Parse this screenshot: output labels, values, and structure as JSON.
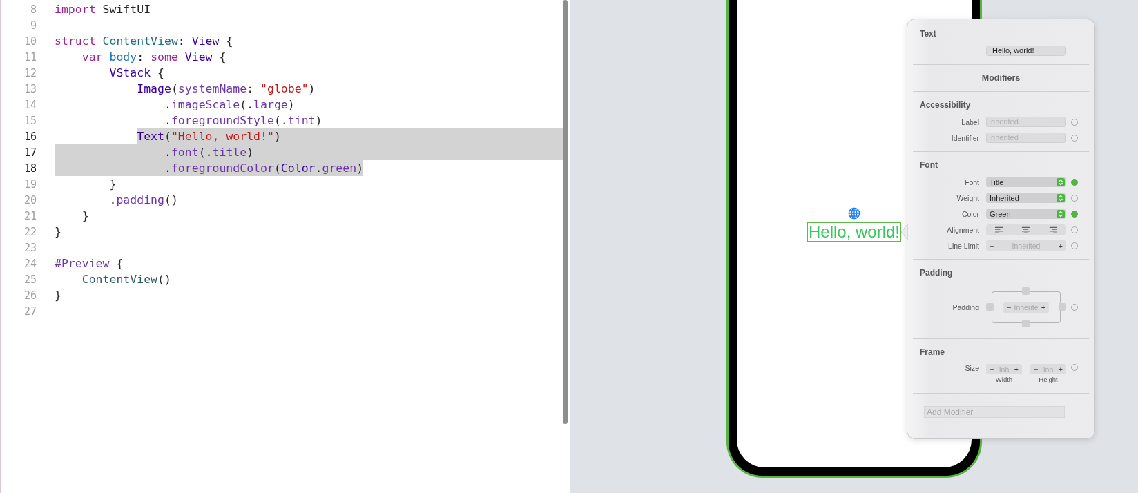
{
  "editor": {
    "lines": [
      {
        "number": "8",
        "selected": false,
        "tokens": [
          {
            "text": "import ",
            "kind": "keyword"
          },
          {
            "text": "SwiftUI",
            "kind": "plain"
          }
        ]
      },
      {
        "number": "9",
        "selected": false
      },
      {
        "number": "10",
        "selected": false,
        "tokens": [
          {
            "text": "struct ",
            "kind": "keyword"
          },
          {
            "text": "ContentView",
            "kind": "decl"
          },
          {
            "text": ": ",
            "kind": "plain"
          },
          {
            "text": "View",
            "kind": "type"
          },
          {
            "text": " {",
            "kind": "plain"
          }
        ]
      },
      {
        "number": "11",
        "selected": false,
        "tokens": [
          {
            "text": "    var ",
            "kind": "keyword"
          },
          {
            "text": "body",
            "kind": "property"
          },
          {
            "text": ": ",
            "kind": "plain"
          },
          {
            "text": "some ",
            "kind": "keyword"
          },
          {
            "text": "View",
            "kind": "type"
          },
          {
            "text": " {",
            "kind": "plain"
          }
        ]
      },
      {
        "number": "12",
        "selected": false,
        "tokens": [
          {
            "text": "        VStack",
            "kind": "type"
          },
          {
            "text": " {",
            "kind": "plain"
          }
        ]
      },
      {
        "number": "13",
        "selected": false,
        "tokens": [
          {
            "text": "            Image",
            "kind": "type"
          },
          {
            "text": "(",
            "kind": "plain"
          },
          {
            "text": "systemName",
            "kind": "member"
          },
          {
            "text": ": ",
            "kind": "plain"
          },
          {
            "text": "\"globe\"",
            "kind": "string"
          },
          {
            "text": ")",
            "kind": "plain"
          }
        ]
      },
      {
        "number": "14",
        "selected": false,
        "tokens": [
          {
            "text": "                .",
            "kind": "plain"
          },
          {
            "text": "imageScale",
            "kind": "member"
          },
          {
            "text": "(.",
            "kind": "plain"
          },
          {
            "text": "large",
            "kind": "member"
          },
          {
            "text": ")",
            "kind": "plain"
          }
        ]
      },
      {
        "number": "15",
        "selected": false,
        "tokens": [
          {
            "text": "                .",
            "kind": "plain"
          },
          {
            "text": "foregroundStyle",
            "kind": "member"
          },
          {
            "text": "(.",
            "kind": "plain"
          },
          {
            "text": "tint",
            "kind": "member"
          },
          {
            "text": ")",
            "kind": "plain"
          }
        ]
      },
      {
        "number": "16",
        "selected": true,
        "tokens": [
          {
            "text": "            Text",
            "kind": "type",
            "selected": true
          },
          {
            "text": "(",
            "kind": "plain",
            "selected": true
          },
          {
            "text": "\"Hello, world!\"",
            "kind": "string",
            "selected": true
          },
          {
            "text": ")",
            "kind": "plain",
            "selected": true
          }
        ]
      },
      {
        "number": "17",
        "selected": true,
        "tokens": [
          {
            "text": "                .",
            "kind": "plain",
            "selected": true
          },
          {
            "text": "font",
            "kind": "member",
            "selected": true
          },
          {
            "text": "(.",
            "kind": "plain",
            "selected": true
          },
          {
            "text": "title",
            "kind": "member",
            "selected": true
          },
          {
            "text": ")",
            "kind": "plain",
            "selected": true
          }
        ]
      },
      {
        "number": "18",
        "selected": true,
        "tokens": [
          {
            "text": "                .",
            "kind": "plain",
            "selected": true
          },
          {
            "text": "foregroundColor",
            "kind": "member",
            "selected": true
          },
          {
            "text": "(",
            "kind": "plain",
            "selected": true
          },
          {
            "text": "Color",
            "kind": "type",
            "selected": true
          },
          {
            "text": ".",
            "kind": "plain",
            "selected": true
          },
          {
            "text": "green",
            "kind": "member",
            "selected": true
          },
          {
            "text": ")",
            "kind": "plain",
            "selected": true
          }
        ]
      },
      {
        "number": "19",
        "selected": false,
        "tokens": [
          {
            "text": "        }",
            "kind": "plain"
          }
        ]
      },
      {
        "number": "20",
        "selected": false,
        "tokens": [
          {
            "text": "        .",
            "kind": "plain"
          },
          {
            "text": "padding",
            "kind": "member"
          },
          {
            "text": "()",
            "kind": "plain"
          }
        ]
      },
      {
        "number": "21",
        "selected": false,
        "tokens": [
          {
            "text": "    }",
            "kind": "plain"
          }
        ]
      },
      {
        "number": "22",
        "selected": false,
        "tokens": [
          {
            "text": "}",
            "kind": "plain"
          }
        ]
      },
      {
        "number": "23",
        "selected": false
      },
      {
        "number": "24",
        "selected": false,
        "tokens": [
          {
            "text": "#Preview",
            "kind": "macro"
          },
          {
            "text": " {",
            "kind": "plain"
          }
        ]
      },
      {
        "number": "25",
        "selected": false,
        "tokens": [
          {
            "text": "    ContentView",
            "kind": "ref"
          },
          {
            "text": "()",
            "kind": "plain"
          }
        ]
      },
      {
        "number": "26",
        "selected": false,
        "tokens": [
          {
            "text": "}",
            "kind": "plain"
          }
        ]
      },
      {
        "number": "27",
        "selected": false
      }
    ]
  },
  "preview": {
    "text": "Hello, world!",
    "selected": true
  },
  "inspector": {
    "title": "Text",
    "value": "Hello, world!",
    "modifiers_title": "Modifiers",
    "sections": [
      {
        "title": "Accessibility",
        "rows": [
          {
            "kind": "text_field",
            "label": "Label",
            "placeholder": "Inherited",
            "set": false
          },
          {
            "kind": "text_field",
            "label": "Identifier",
            "placeholder": "Inherited",
            "set": false
          }
        ]
      },
      {
        "title": "Font",
        "rows": [
          {
            "kind": "popup",
            "label": "Font",
            "value": "Title",
            "set": true
          },
          {
            "kind": "popup",
            "label": "Weight",
            "value": "Inherited",
            "set": false
          },
          {
            "kind": "popup",
            "label": "Color",
            "value": "Green",
            "set": true
          },
          {
            "kind": "alignment",
            "label": "Alignment",
            "set": false
          },
          {
            "kind": "stepper",
            "label": "Line Limit",
            "minus": "−",
            "placeholder": "Inherited",
            "plus": "+",
            "set": false
          }
        ]
      },
      {
        "title": "Padding",
        "rows": [
          {
            "kind": "padding",
            "label": "Padding",
            "minus": "−",
            "placeholder": "Inherite",
            "plus": "+",
            "set": false
          }
        ]
      },
      {
        "title": "Frame",
        "rows": [
          {
            "kind": "size",
            "label": "Size",
            "set": false,
            "fields": [
              {
                "minus": "−",
                "placeholder": "Inh",
                "plus": "+",
                "caption": "Width"
              },
              {
                "minus": "−",
                "placeholder": "Inh",
                "plus": "+",
                "caption": "Height"
              }
            ]
          }
        ]
      }
    ],
    "add_modifier": {
      "placeholder": "Add Modifier"
    }
  }
}
